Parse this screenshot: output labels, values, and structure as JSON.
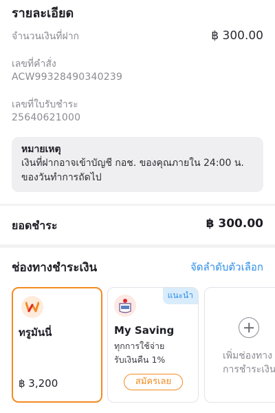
{
  "details": {
    "title": "รายละเอียด",
    "deposit_label": "จำนวนเงินที่ฝาก",
    "deposit_amount": "฿ 300.00",
    "order_label": "เลขที่คำสั่ง",
    "order_number": "ACW99328490340239",
    "receipt_label": "เลขที่ใบรับชำระ",
    "receipt_number": "25640621000"
  },
  "note": {
    "title": "หมายเหตุ",
    "line1": "เงินที่ฝากอาจเข้าบัญชี กอช. ของคุณภายใน 24:00 น.",
    "line2": "ของวันทำการถัดไป"
  },
  "total": {
    "label": "ยอดชำระ",
    "amount": "฿ 300.00"
  },
  "payment": {
    "title": "ช่องทางชำระเงิน",
    "reorder_link": "จัดลำดับตัวเลือก",
    "methods": [
      {
        "name": "ทรูมันนี่",
        "balance": "฿ 3,200",
        "icon": "truemoney-logo-icon",
        "selected": true
      },
      {
        "name": "My Saving",
        "badge": "แนะนำ",
        "desc1": "ทุกการใช้จ่าย",
        "desc2": "รับเงินคืน 1%",
        "button": "สมัครเลย",
        "icon": "kkp-logo-icon"
      },
      {
        "line1": "เพิ่มช่องทาง",
        "line2": "การชำระเงิน",
        "icon": "plus-icon"
      }
    ]
  },
  "colors": {
    "accent": "#f28a20",
    "link": "#2f8ee8",
    "badge_bg": "#d9ecfb"
  }
}
